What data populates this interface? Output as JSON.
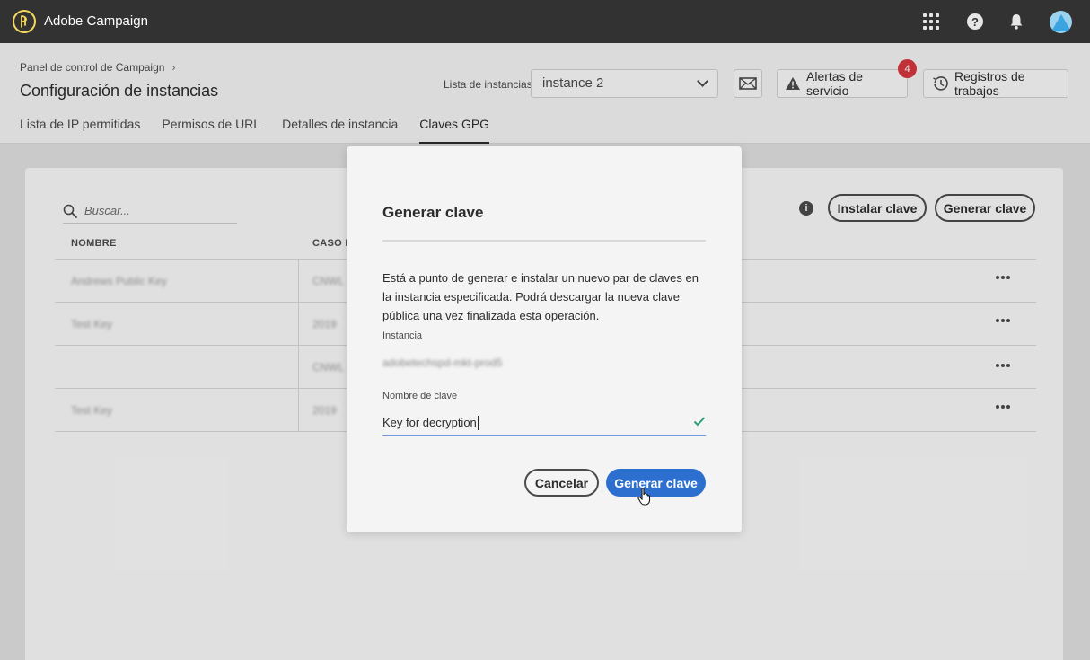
{
  "app": {
    "title": "Adobe Campaign"
  },
  "topbar": {
    "icons": [
      "apps-grid-icon",
      "help-icon",
      "bell-icon",
      "avatar"
    ]
  },
  "header": {
    "breadcrumb": "Panel de control de Campaign",
    "title": "Configuración de instancias",
    "instance_label": "Lista de instancias",
    "instance_selected": "instance 2",
    "alerts_label": "Alertas de servicio",
    "alerts_count": "4",
    "logs_label": "Registros de trabajos"
  },
  "tabs": [
    {
      "label": "Lista de IP permitidas",
      "active": false
    },
    {
      "label": "Permisos de URL",
      "active": false
    },
    {
      "label": "Detalles de instancia",
      "active": false
    },
    {
      "label": "Claves GPG",
      "active": true
    }
  ],
  "card": {
    "search_placeholder": "Buscar...",
    "install_label": "Instalar clave",
    "generate_label": "Generar clave",
    "columns": [
      "NOMBRE",
      "CASO D"
    ],
    "rows": [
      {
        "name": "Andrews Public Key",
        "case": "CNWL"
      },
      {
        "name": "Test Key",
        "case": "2019"
      },
      {
        "name": "",
        "case": "CNWL"
      },
      {
        "name": "Test Key",
        "case": "2019"
      }
    ]
  },
  "dialog": {
    "title": "Generar clave",
    "message": "Está a punto de generar e instalar un nuevo par de claves en la instancia especificada. Podrá descargar la nueva clave pública una vez finalizada esta operación.",
    "instance_label": "Instancia",
    "instance_value": "adobetechspd-mkt-prod5",
    "key_name_label": "Nombre de clave",
    "key_name_value": "Key for decryption",
    "cancel_label": "Cancelar",
    "confirm_label": "Generar clave"
  },
  "colors": {
    "topbar_bg": "#323232",
    "primary_button": "#2c6fce",
    "badge": "#d7373f",
    "check": "#2d9d78"
  }
}
